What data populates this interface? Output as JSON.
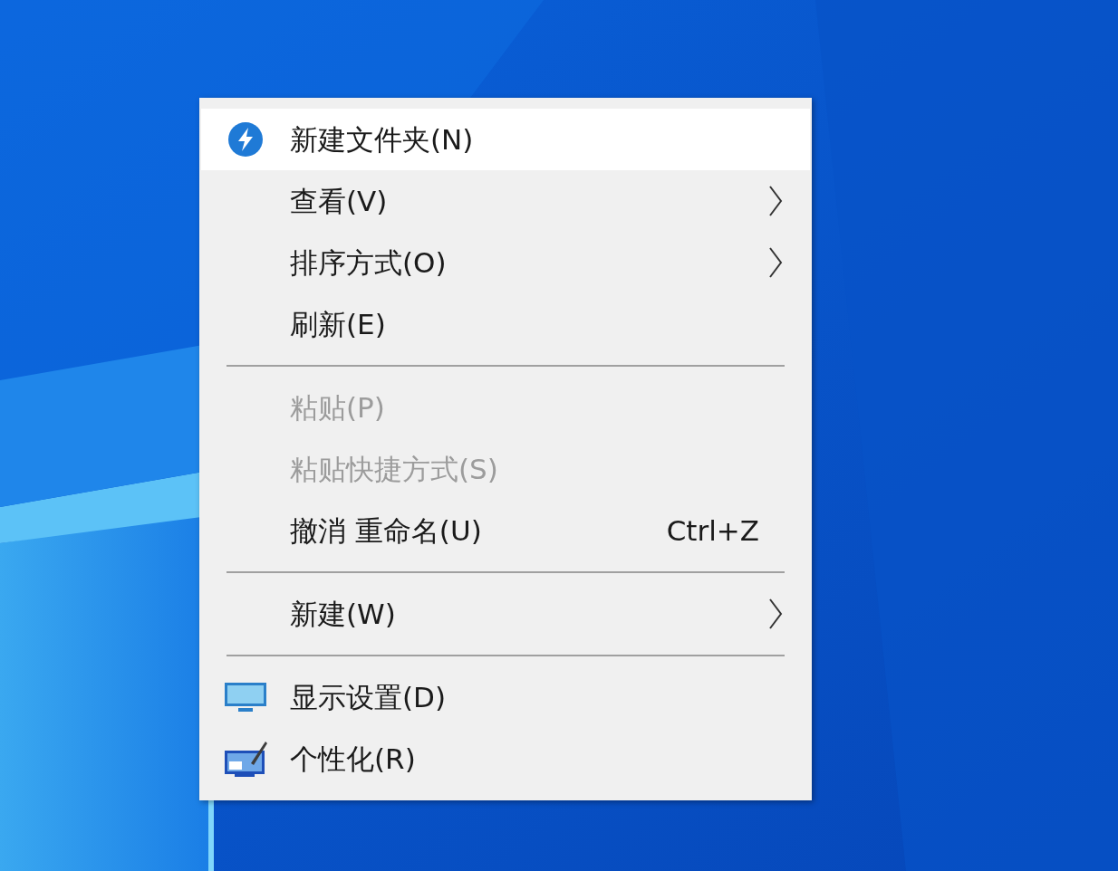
{
  "context_menu": {
    "items": [
      {
        "kind": "item",
        "label": "新建文件夹(N)",
        "selected": true,
        "disabled": false,
        "submenu": false
      },
      {
        "kind": "item",
        "label": "查看(V)",
        "selected": false,
        "disabled": false,
        "submenu": true
      },
      {
        "kind": "item",
        "label": "排序方式(O)",
        "selected": false,
        "disabled": false,
        "submenu": true
      },
      {
        "kind": "item",
        "label": "刷新(E)",
        "selected": false,
        "disabled": false,
        "submenu": false
      },
      {
        "kind": "separator"
      },
      {
        "kind": "item",
        "label": "粘贴(P)",
        "selected": false,
        "disabled": true,
        "submenu": false
      },
      {
        "kind": "item",
        "label": "粘贴快捷方式(S)",
        "selected": false,
        "disabled": true,
        "submenu": false
      },
      {
        "kind": "item",
        "label": "撤消 重命名(U)",
        "shortcut": "Ctrl+Z",
        "selected": false,
        "disabled": false,
        "submenu": false
      },
      {
        "kind": "separator"
      },
      {
        "kind": "item",
        "label": "新建(W)",
        "selected": false,
        "disabled": false,
        "submenu": true
      },
      {
        "kind": "separator"
      },
      {
        "kind": "item",
        "label": "显示设置(D)",
        "selected": false,
        "disabled": false,
        "submenu": false
      },
      {
        "kind": "item",
        "label": "个性化(R)",
        "selected": false,
        "disabled": false,
        "submenu": false
      }
    ]
  }
}
